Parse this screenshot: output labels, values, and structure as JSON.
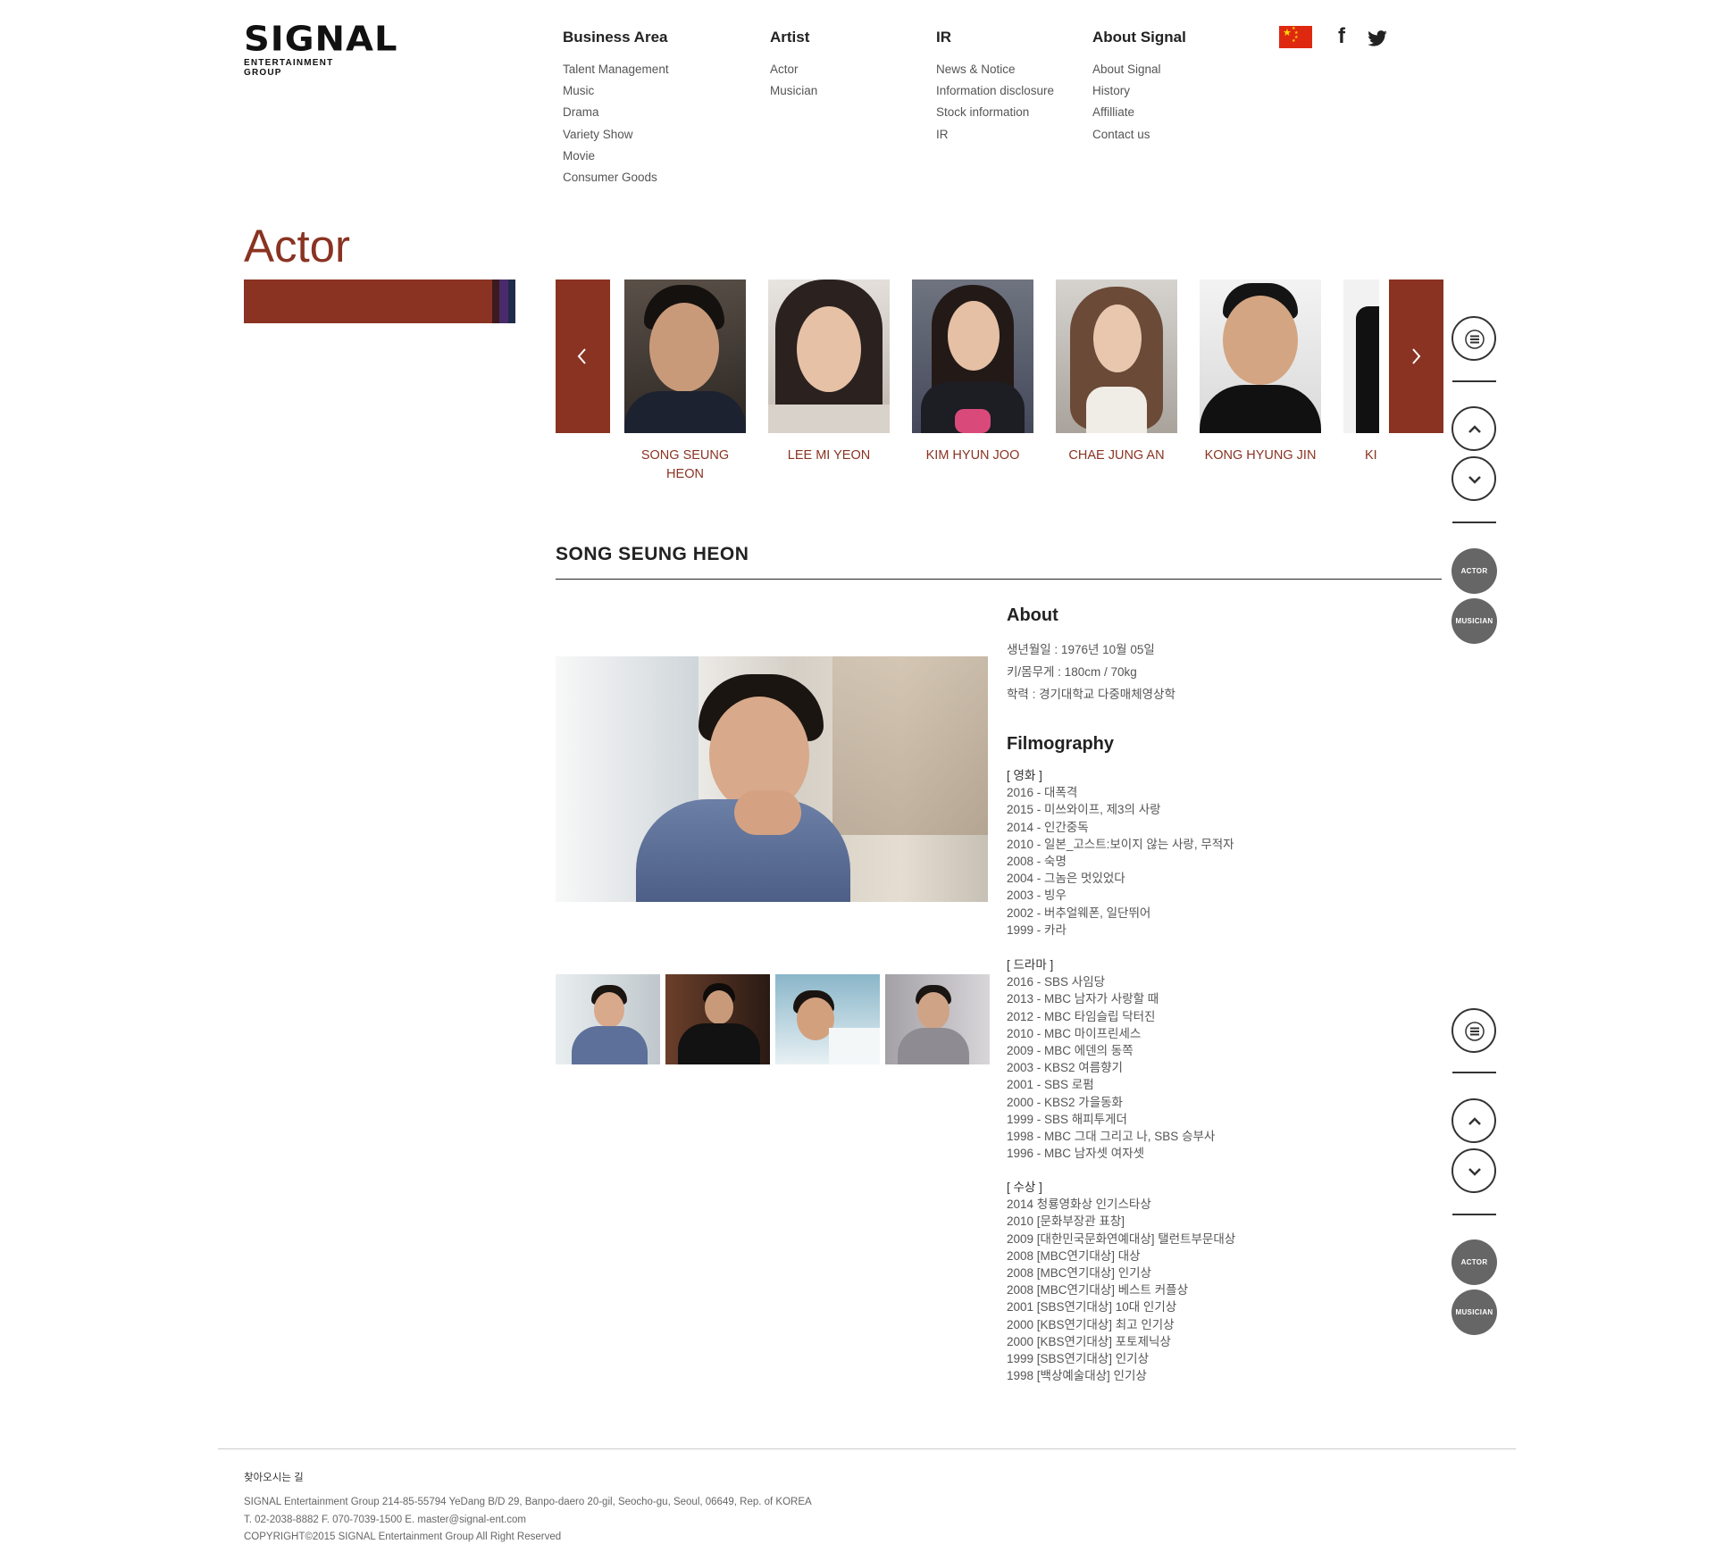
{
  "logo": {
    "word": "SIGNAL",
    "sub": "ENTERTAINMENT GROUP"
  },
  "nav": [
    {
      "heading": "Business Area",
      "links": [
        "Talent Management",
        "Music",
        "Drama",
        "Variety Show",
        "Movie",
        "Consumer Goods"
      ]
    },
    {
      "heading": "Artist",
      "links": [
        "Actor",
        "Musician"
      ]
    },
    {
      "heading": "IR",
      "links": [
        "News & Notice",
        "Information disclosure",
        "Stock information",
        "IR"
      ]
    },
    {
      "heading": "About Signal",
      "links": [
        "About Signal",
        "History",
        "Affilliate",
        "Contact us"
      ]
    }
  ],
  "icons": {
    "language": "china-flag-icon",
    "facebook": "f",
    "twitter": "twitter-icon"
  },
  "page_title": "Actor",
  "carousel": {
    "prev_icon": "chevron-left-icon",
    "next_icon": "chevron-right-icon",
    "actors": [
      {
        "name": "SONG SEUNG HEON"
      },
      {
        "name": "LEE MI YEON"
      },
      {
        "name": "KIM HYUN JOO"
      },
      {
        "name": "CHAE JUNG AN"
      },
      {
        "name": "KONG HYUNG JIN"
      },
      {
        "name": "KI"
      }
    ]
  },
  "profile": {
    "name": "SONG SEUNG HEON",
    "about_title": "About",
    "about_lines": [
      "생년월일 : 1976년 10월 05일",
      "키/몸무게 : 180cm / 70kg",
      "학력 : 경기대학교 다중매체영상학"
    ],
    "filmography_title": "Filmography",
    "movies_label": "[ 영화 ]",
    "movies": [
      "2016 - 대폭격",
      "2015 - 미쓰와이프, 제3의 사랑",
      "2014 - 인간중독",
      "2010 - 일본_고스트:보이지 않는 사랑, 무적자",
      "2008 - 숙명",
      "2004 - 그놈은 멋있었다",
      "2003 - 빙우",
      "2002 - 버추얼웨폰, 일단뛰어",
      "1999 - 카라"
    ],
    "drama_label": "[ 드라마 ]",
    "dramas": [
      "2016 - SBS 사임당",
      "2013 - MBC 남자가 사랑할 때",
      "2012 - MBC 타임슬립 닥터진",
      "2010 - MBC 마이프린세스",
      "2009 - MBC 에덴의 동쪽",
      "2003 - KBS2 여름향기",
      "2001 - SBS 로펌",
      "2000 - KBS2 가을동화",
      "1999 - SBS 해피투게더",
      "1998 - MBC 그대 그리고 나, SBS 승부사",
      "1996 - MBC 남자셋 여자셋"
    ],
    "awards_label": "[ 수상 ]",
    "awards": [
      "2014 청룡영화상 인기스타상",
      "2010 [문화부장관 표창]",
      "2009 [대한민국문화연예대상] 탤런트부문대상",
      "2008 [MBC연기대상] 대상",
      "2008 [MBC연기대상] 인기상",
      "2008 [MBC연기대상] 베스트 커플상",
      "2001 [SBS연기대상] 10대 인기상",
      "2000 [KBS연기대상] 최고 인기상",
      "2000 [KBS연기대상] 포토제닉상",
      "1999 [SBS연기대상] 인기상",
      "1998 [백상예술대상] 인기상"
    ]
  },
  "side_controls": {
    "actor_label": "ACTOR",
    "musician_label": "MUSICIAN"
  },
  "footer": {
    "title": "찾아오시는 길",
    "line1": "SIGNAL Entertainment Group 214-85-55794 YeDang B/D 29, Banpo-daero 20-gil, Seocho-gu, Seoul, 06649, Rep. of KOREA",
    "line2": "T. 02-2038-8882 F. 070-7039-1500 E. master@signal-ent.com",
    "line3": "COPYRIGHT©2015 SIGNAL Entertainment Group All Right Reserved"
  },
  "colors": {
    "accent": "#8a3322",
    "text": "#555555",
    "control": "#333333",
    "badge": "#666666"
  }
}
